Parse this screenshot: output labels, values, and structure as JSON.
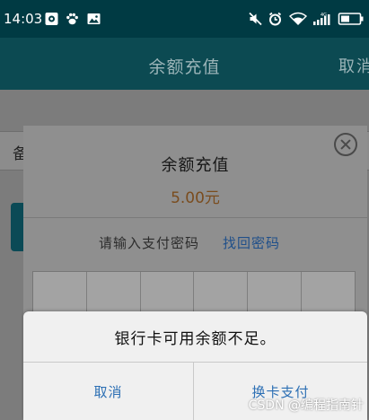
{
  "status_bar": {
    "time": "14:03",
    "left_icons": [
      "app-notification-icon",
      "paw-icon",
      "image-icon"
    ],
    "right_icons": [
      "mute-icon",
      "alarm-icon",
      "wifi-icon",
      "signal-icon",
      "battery-icon"
    ],
    "signal_label": "4G"
  },
  "header": {
    "title": "余额充值",
    "action": "取消"
  },
  "underlying_page": {
    "row_char": "备"
  },
  "pay_dialog": {
    "title": "余额充值",
    "amount": "5.00元",
    "prompt": "请输入支付密码",
    "forgot_link": "找回密码",
    "pin_cells": 6
  },
  "alert": {
    "message": "银行卡可用余额不足。",
    "cancel_label": "取消",
    "switch_label": "换卡支付"
  },
  "watermark": "CSDN @编程指南针",
  "colors": {
    "header_bg": "#0c4a52",
    "status_bar_bg": "#003a43",
    "link_blue": "#2c6fb4",
    "amount_orange": "#7a4c1e"
  }
}
